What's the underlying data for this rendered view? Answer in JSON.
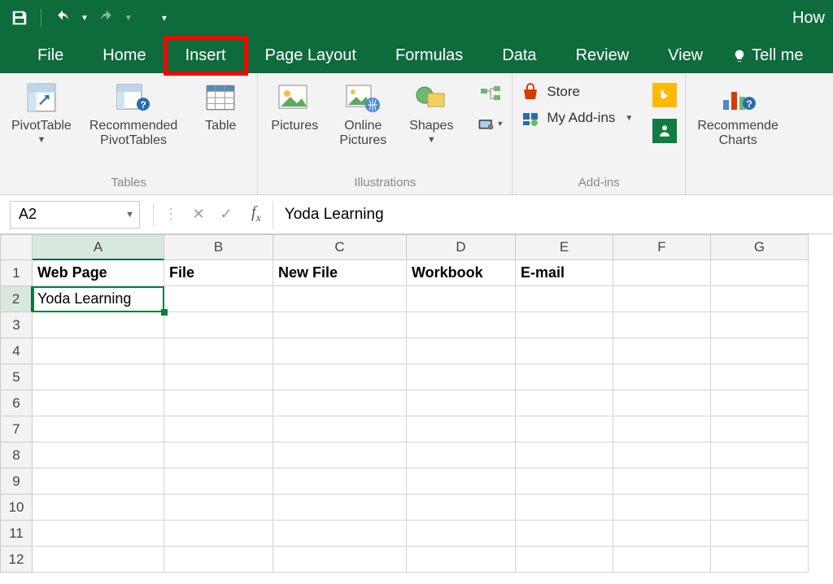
{
  "title_bar": {
    "right_text": "How"
  },
  "tabs": {
    "file": "File",
    "items": [
      "Home",
      "Insert",
      "Page Layout",
      "Formulas",
      "Data",
      "Review",
      "View"
    ],
    "active": "Insert",
    "tellme": "Tell me"
  },
  "ribbon": {
    "tables": {
      "pivot": "PivotTable",
      "recpivot_l1": "Recommended",
      "recpivot_l2": "PivotTables",
      "table": "Table",
      "group": "Tables"
    },
    "illus": {
      "pictures": "Pictures",
      "online_l1": "Online",
      "online_l2": "Pictures",
      "shapes": "Shapes",
      "group": "Illustrations"
    },
    "addins": {
      "store": "Store",
      "myaddins": "My Add-ins",
      "group": "Add-ins"
    },
    "charts": {
      "rec_l1": "Recommende",
      "rec_l2": "Charts"
    }
  },
  "formula": {
    "namebox": "A2",
    "value": "Yoda Learning"
  },
  "columns": [
    "A",
    "B",
    "C",
    "D",
    "E",
    "F",
    "G"
  ],
  "rows": [
    "1",
    "2",
    "3",
    "4",
    "5",
    "6",
    "7",
    "8",
    "9",
    "10",
    "11",
    "12"
  ],
  "cells": {
    "A1": "Web Page",
    "B1": "File",
    "C1": "New File",
    "D1": "Workbook",
    "E1": "E-mail",
    "A2": "Yoda Learning"
  }
}
